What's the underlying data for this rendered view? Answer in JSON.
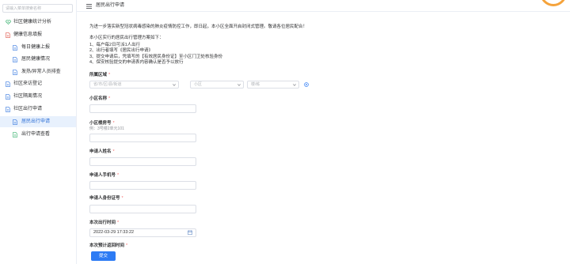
{
  "sidebar": {
    "search_placeholder": "请输入菜单搜索名称",
    "items": [
      {
        "label": "社区健康统计分析",
        "icon": "health-analysis-icon",
        "icon_color": "#3cb371"
      },
      {
        "label": "健康信息填报",
        "icon": "document-icon",
        "icon_color": "#e05a4f"
      },
      {
        "label": "每日健康上报",
        "icon": "document-icon",
        "icon_color": "#3a7be0"
      },
      {
        "label": "居民健康情况",
        "icon": "document-icon",
        "icon_color": "#3a7be0"
      },
      {
        "label": "发热/异常人员排查",
        "icon": "document-icon",
        "icon_color": "#3a7be0"
      },
      {
        "label": "社区来访登记",
        "icon": "document-icon",
        "icon_color": "#3a7be0"
      },
      {
        "label": "社区隔离情况",
        "icon": "document-icon",
        "icon_color": "#3a7be0"
      },
      {
        "label": "社区出行申请",
        "icon": "document-icon",
        "icon_color": "#3a7be0"
      },
      {
        "label": "居民出行申请",
        "icon": "document-icon",
        "icon_color": "#3a7be0",
        "active": true
      },
      {
        "label": "出行申请查看",
        "icon": "document-icon",
        "icon_color": "#3cb371"
      }
    ]
  },
  "header": {
    "title": "居民出行申请",
    "menu_icon": "hamburger-menu-icon",
    "logo_color": "#f5a33b"
  },
  "notice": {
    "intro": "为进一步落实新型冠状病毒感染的肺炎疫情防控工作，即日起，本小区全面开启封闭式管理。敬请各位居民配合！",
    "plan_title": "本小区实行的居民出行管理方案如下：",
    "rules": [
      "1、每户每2日可派1人出行",
      "2、出行者填写《居民出行申请》",
      "3、提交申请后，凭填写的【有效居民身份证】至小区门卫处核验身份",
      "4、保安核验提交的申请表内容确认是否予以放行"
    ]
  },
  "form": {
    "region": {
      "label": "所属区域",
      "required": "*",
      "placeholders": [
        "省/市/区/县/街道",
        "小区",
        "楼/栋"
      ],
      "locate_icon": "locate-icon"
    },
    "community_name": {
      "label": "小区名称",
      "required": "*"
    },
    "room_number": {
      "label": "小区楼房号",
      "required": "*",
      "hint": "例：3号楼2单元101"
    },
    "applicant_name": {
      "label": "申请人姓名",
      "required": "*"
    },
    "applicant_phone": {
      "label": "申请人手机号",
      "required": "*"
    },
    "applicant_id": {
      "label": "申请人身份证号",
      "required": "*"
    },
    "departure_time": {
      "label": "本次出行时间",
      "required": "*",
      "value": "2022-03-29 17:33:22",
      "icon": "calendar-icon"
    },
    "return_time": {
      "label": "本次预计返回时间",
      "required": "*"
    }
  },
  "submit_label": "提交",
  "colors": {
    "accent": "#2d7bf4",
    "active_bg": "#e8f1fd",
    "required": "#f56c6c"
  }
}
